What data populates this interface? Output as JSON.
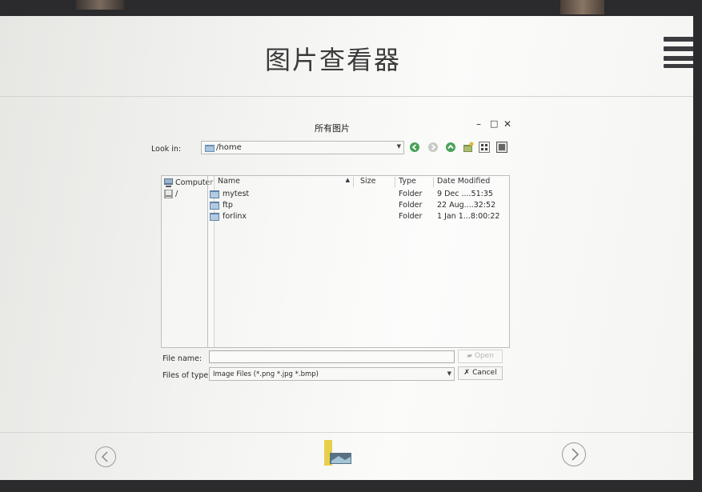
{
  "app": {
    "title": "图片查看器"
  },
  "dialog": {
    "title": "所有图片",
    "window_buttons": {
      "minimize": "–",
      "maximize": "□",
      "close": "✕"
    },
    "look_in": {
      "label": "Look in:",
      "value": "/home"
    },
    "toolbar": [
      "back-icon",
      "forward-icon",
      "parent-dir-icon",
      "new-folder-icon",
      "list-view-icon",
      "detail-view-icon"
    ],
    "sidebar": [
      {
        "label": "Computer",
        "icon": "computer-icon"
      },
      {
        "label": "/",
        "icon": "drive-icon"
      }
    ],
    "columns": [
      "Name",
      "Size",
      "Type",
      "Date Modified"
    ],
    "files": [
      {
        "name": "mytest",
        "size": "",
        "type": "Folder",
        "date": "9 Dec ....51:35"
      },
      {
        "name": "ftp",
        "size": "",
        "type": "Folder",
        "date": "22 Aug....32:52"
      },
      {
        "name": "forlinx",
        "size": "",
        "type": "Folder",
        "date": "1 Jan 1...8:00:22"
      }
    ],
    "file_name": {
      "label": "File name:",
      "value": ""
    },
    "files_of_type": {
      "label": "Files of type:",
      "value": "Image Files (*.png *.jpg *.bmp)"
    },
    "open_label": "Open",
    "cancel_label": "Cancel"
  },
  "bottom": {
    "prev": "chevron-left-icon",
    "next": "chevron-right-icon",
    "thumb": "image-thumbnail-icon"
  }
}
